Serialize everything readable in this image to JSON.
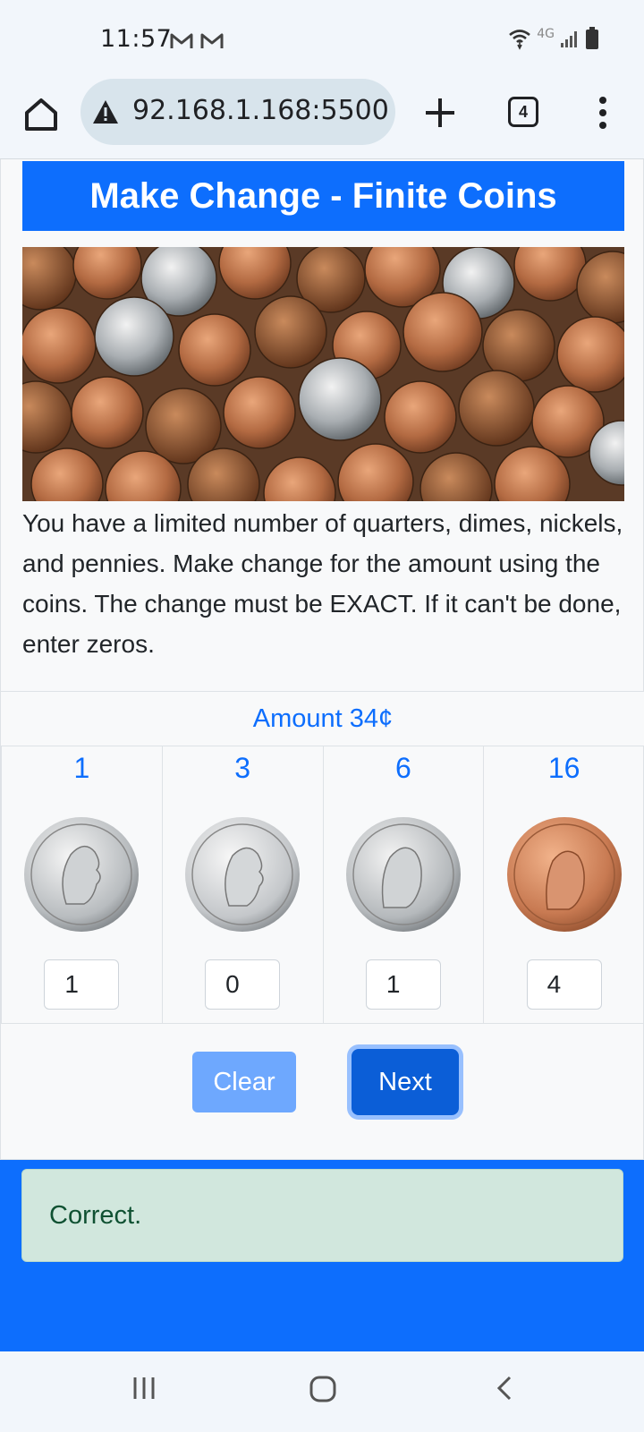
{
  "status_bar": {
    "time": "11:57",
    "network": "4G",
    "icons": [
      "gmail-icon",
      "gmail-icon",
      "wifi-icon",
      "signal-icon",
      "battery-icon"
    ]
  },
  "browser": {
    "url": "92.168.1.168:5500",
    "tab_count": "4"
  },
  "page": {
    "title": "Make Change - Finite Coins",
    "intro": "You have a limited number of quarters, dimes, nickels, and pennies. Make change for the amount using the coins. The change must be EXACT. If it can't be done, enter zeros.",
    "amount_label": "Amount 34¢",
    "coins": [
      {
        "name": "quarter",
        "available": "1",
        "entered": "1"
      },
      {
        "name": "dime",
        "available": "3",
        "entered": "0"
      },
      {
        "name": "nickel",
        "available": "6",
        "entered": "1"
      },
      {
        "name": "penny",
        "available": "16",
        "entered": "4"
      }
    ],
    "clear_label": "Clear",
    "next_label": "Next",
    "result": "Correct."
  },
  "colors": {
    "primary": "#0d6efd",
    "success_bg": "#d1e7dd",
    "success_text": "#0f5132"
  }
}
